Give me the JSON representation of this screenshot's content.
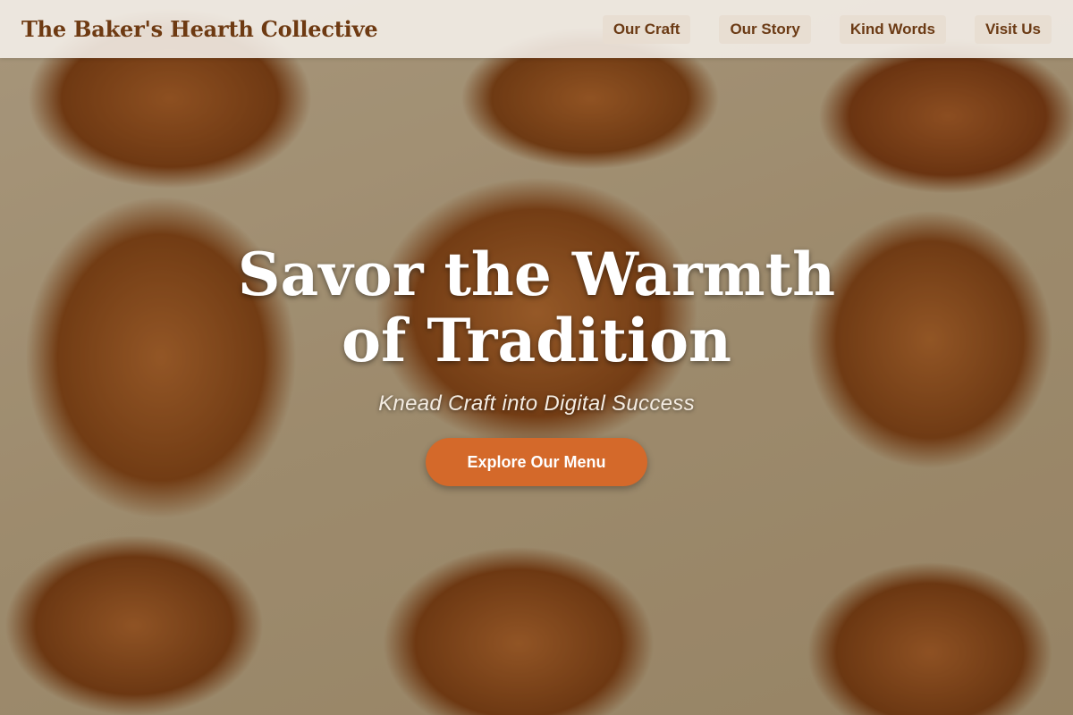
{
  "site": {
    "brand": "The Baker's Hearth Collective"
  },
  "nav": {
    "items": [
      {
        "label": "Our Craft"
      },
      {
        "label": "Our Story"
      },
      {
        "label": "Kind Words"
      },
      {
        "label": "Visit Us"
      }
    ]
  },
  "hero": {
    "title": "Savor the Warmth of Tradition",
    "subtitle": "Knead Craft into Digital Success",
    "cta_label": "Explore Our Menu"
  },
  "colors": {
    "brand_text": "#6e3a12",
    "cta_background": "#d4692a",
    "nav_background": "#f6f1ec"
  }
}
